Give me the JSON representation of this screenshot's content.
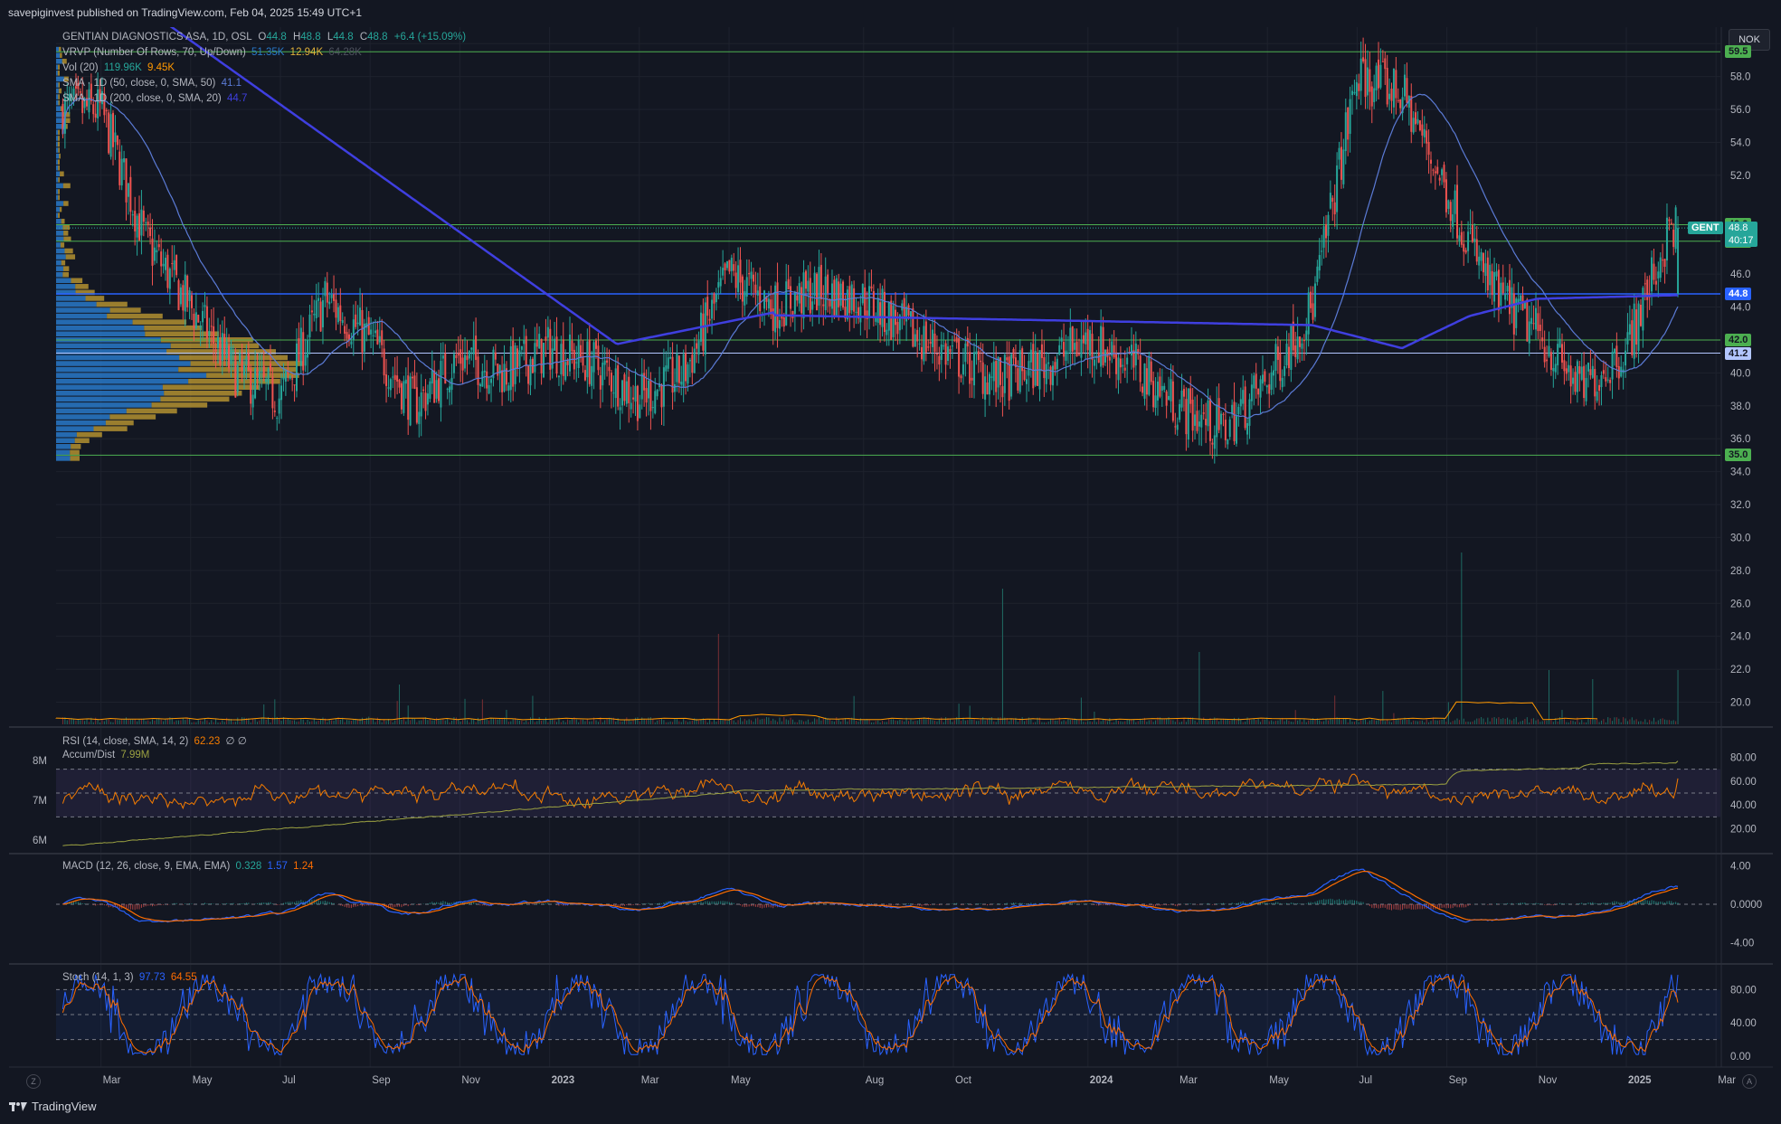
{
  "header": {
    "published": "savepiginvest published on TradingView.com, Feb 04, 2025 15:49 UTC+1"
  },
  "brand": {
    "name": "TradingView",
    "icon": "tradingview-logo-icon"
  },
  "currency_button": "NOK",
  "corner_buttons": {
    "left": "Z",
    "right": "A"
  },
  "legend": {
    "symbol": "GENTIAN DIAGNOSTICS ASA, 1D, OSL",
    "ohlc": {
      "o_label": "O",
      "o": "44.8",
      "h_label": "H",
      "h": "48.8",
      "l_label": "L",
      "l": "44.8",
      "c_label": "C",
      "c": "48.8",
      "change": "+6.4 (+15.09%)"
    },
    "vrvp": {
      "label": "VRVP (Number Of Rows, 70, Up/Down)",
      "v1": "51.35K",
      "v2": "12.94K",
      "v3": "64.28K"
    },
    "vol": {
      "label": "Vol (20)",
      "v1": "119.96K",
      "v2": "9.45K"
    },
    "sma50": {
      "label": "SMA · 1D (50, close, 0, SMA, 50)",
      "value": "41.1"
    },
    "sma200": {
      "label": "SMA · 1D (200, close, 0, SMA, 20)",
      "value": "44.7"
    },
    "rsi": {
      "label": "RSI (14, close, SMA, 14, 2)",
      "value": "62.23",
      "extra": "∅ ∅"
    },
    "ad": {
      "label": "Accum/Dist",
      "value": "7.99M"
    },
    "macd": {
      "label": "MACD (12, 26, close, 9, EMA, EMA)",
      "v1": "0.328",
      "v2": "1.57",
      "v3": "1.24"
    },
    "stoch": {
      "label": "Stoch (14, 1, 3)",
      "v1": "97.73",
      "v2": "64.55"
    }
  },
  "price_tags": [
    {
      "text": "59.5",
      "price": 59.5,
      "color": "#4caf50"
    },
    {
      "text": "49.0",
      "price": 49.0,
      "color": "#4caf50"
    },
    {
      "text": "48.0",
      "price": 48.0,
      "color": "#4caf50"
    },
    {
      "text": "44.8",
      "price": 44.8,
      "color": "#2962ff"
    },
    {
      "text": "42.0",
      "price": 42.0,
      "color": "#4caf50"
    },
    {
      "text": "41.2",
      "price": 41.2,
      "color": "#b3c6ff"
    },
    {
      "text": "35.0",
      "price": 35.0,
      "color": "#4caf50"
    }
  ],
  "last_price": {
    "symbol": "GENT",
    "price": "48.8",
    "countdown": "40:17",
    "color": "#26a69a"
  },
  "chart_data": [
    {
      "type": "candlestick",
      "title": "GENTIAN DIAGNOSTICS ASA, 1D, OSL",
      "x_labels": [
        "Mar",
        "May",
        "Jul",
        "Sep",
        "Nov",
        "2023",
        "Mar",
        "May",
        "Aug",
        "Oct",
        "2024",
        "Mar",
        "May",
        "Jul",
        "Sep",
        "Nov",
        "2025",
        "Mar"
      ],
      "y_ticks": [
        20.0,
        22.0,
        24.0,
        26.0,
        28.0,
        30.0,
        32.0,
        34.0,
        36.0,
        38.0,
        40.0,
        44.0,
        46.0,
        52.0,
        54.0,
        56.0,
        58.0,
        60.0
      ],
      "ylim": [
        18.6,
        61.0
      ],
      "horizontal_levels": [
        59.5,
        49.0,
        48.0,
        42.0,
        41.2,
        35.0
      ],
      "sma200_level_line": 44.8,
      "price_path_approx": [
        {
          "x": "2022-03",
          "price": 56.0
        },
        {
          "x": "2022-04",
          "price": 48.0
        },
        {
          "x": "2022-05",
          "price": 44.0
        },
        {
          "x": "2022-06",
          "price": 40.0
        },
        {
          "x": "2022-07",
          "price": 38.5
        },
        {
          "x": "2022-08",
          "price": 44.5
        },
        {
          "x": "2022-09",
          "price": 42.0
        },
        {
          "x": "2022-10",
          "price": 38.0
        },
        {
          "x": "2022-11",
          "price": 41.0
        },
        {
          "x": "2022-12",
          "price": 40.0
        },
        {
          "x": "2023-01",
          "price": 41.5
        },
        {
          "x": "2023-02",
          "price": 40.5
        },
        {
          "x": "2023-03",
          "price": 38.5
        },
        {
          "x": "2023-04",
          "price": 40.0
        },
        {
          "x": "2023-05",
          "price": 46.0
        },
        {
          "x": "2023-06",
          "price": 44.0
        },
        {
          "x": "2023-07",
          "price": 45.0
        },
        {
          "x": "2023-08",
          "price": 44.5
        },
        {
          "x": "2023-09",
          "price": 42.5
        },
        {
          "x": "2023-10",
          "price": 41.0
        },
        {
          "x": "2023-11",
          "price": 39.5
        },
        {
          "x": "2023-12",
          "price": 40.5
        },
        {
          "x": "2024-01",
          "price": 42.0
        },
        {
          "x": "2024-02",
          "price": 40.5
        },
        {
          "x": "2024-03",
          "price": 38.0
        },
        {
          "x": "2024-04",
          "price": 36.5
        },
        {
          "x": "2024-05",
          "price": 39.5
        },
        {
          "x": "2024-06",
          "price": 44.0
        },
        {
          "x": "2024-07",
          "price": 58.0
        },
        {
          "x": "2024-08",
          "price": 57.0
        },
        {
          "x": "2024-09",
          "price": 51.0
        },
        {
          "x": "2024-10",
          "price": 45.0
        },
        {
          "x": "2024-11",
          "price": 42.5
        },
        {
          "x": "2024-12",
          "price": 39.0
        },
        {
          "x": "2025-01",
          "price": 41.5
        },
        {
          "x": "2025-02",
          "price": 48.8
        }
      ]
    },
    {
      "type": "line",
      "title": "RSI (14, close, SMA, 14, 2)",
      "y_ticks": [
        20.0,
        40.0,
        60.0,
        80.0
      ],
      "bands": [
        30,
        70
      ],
      "last": 62.23
    },
    {
      "type": "line",
      "title": "Accum/Dist",
      "y_ticks_label": [
        "8M",
        "7M",
        "6M"
      ],
      "last": "7.99M"
    },
    {
      "type": "line",
      "title": "MACD (12, 26, close, 9, EMA, EMA)",
      "y_ticks": [
        -4.0,
        0.0,
        4.0
      ],
      "y_tick_labels": [
        "-4.00",
        "0.0000",
        "4.00"
      ],
      "last": {
        "macd": 0.328,
        "signal": 1.57,
        "hist": 1.24
      }
    },
    {
      "type": "line",
      "title": "Stoch (14, 1, 3)",
      "y_ticks": [
        0.0,
        40.0,
        80.0
      ],
      "y_tick_labels": [
        "0.00",
        "40.00",
        "80.00"
      ],
      "bands": [
        20,
        80
      ],
      "last": {
        "k": 97.73,
        "d": 64.55
      }
    }
  ],
  "colors": {
    "bg": "#131722",
    "up": "#26a69a",
    "down": "#ef5350",
    "sma50": "#5b7bd6",
    "sma200": "#3f3fe0",
    "level": "#4caf50",
    "rsi": "#f57c00",
    "ad": "#9aa041",
    "macd": "#2962ff",
    "signal": "#ff6d00",
    "stoch_k": "#2962ff",
    "stoch_d": "#ff6d00",
    "vp_up": "#2979c9",
    "vp_down": "#c8a233"
  }
}
